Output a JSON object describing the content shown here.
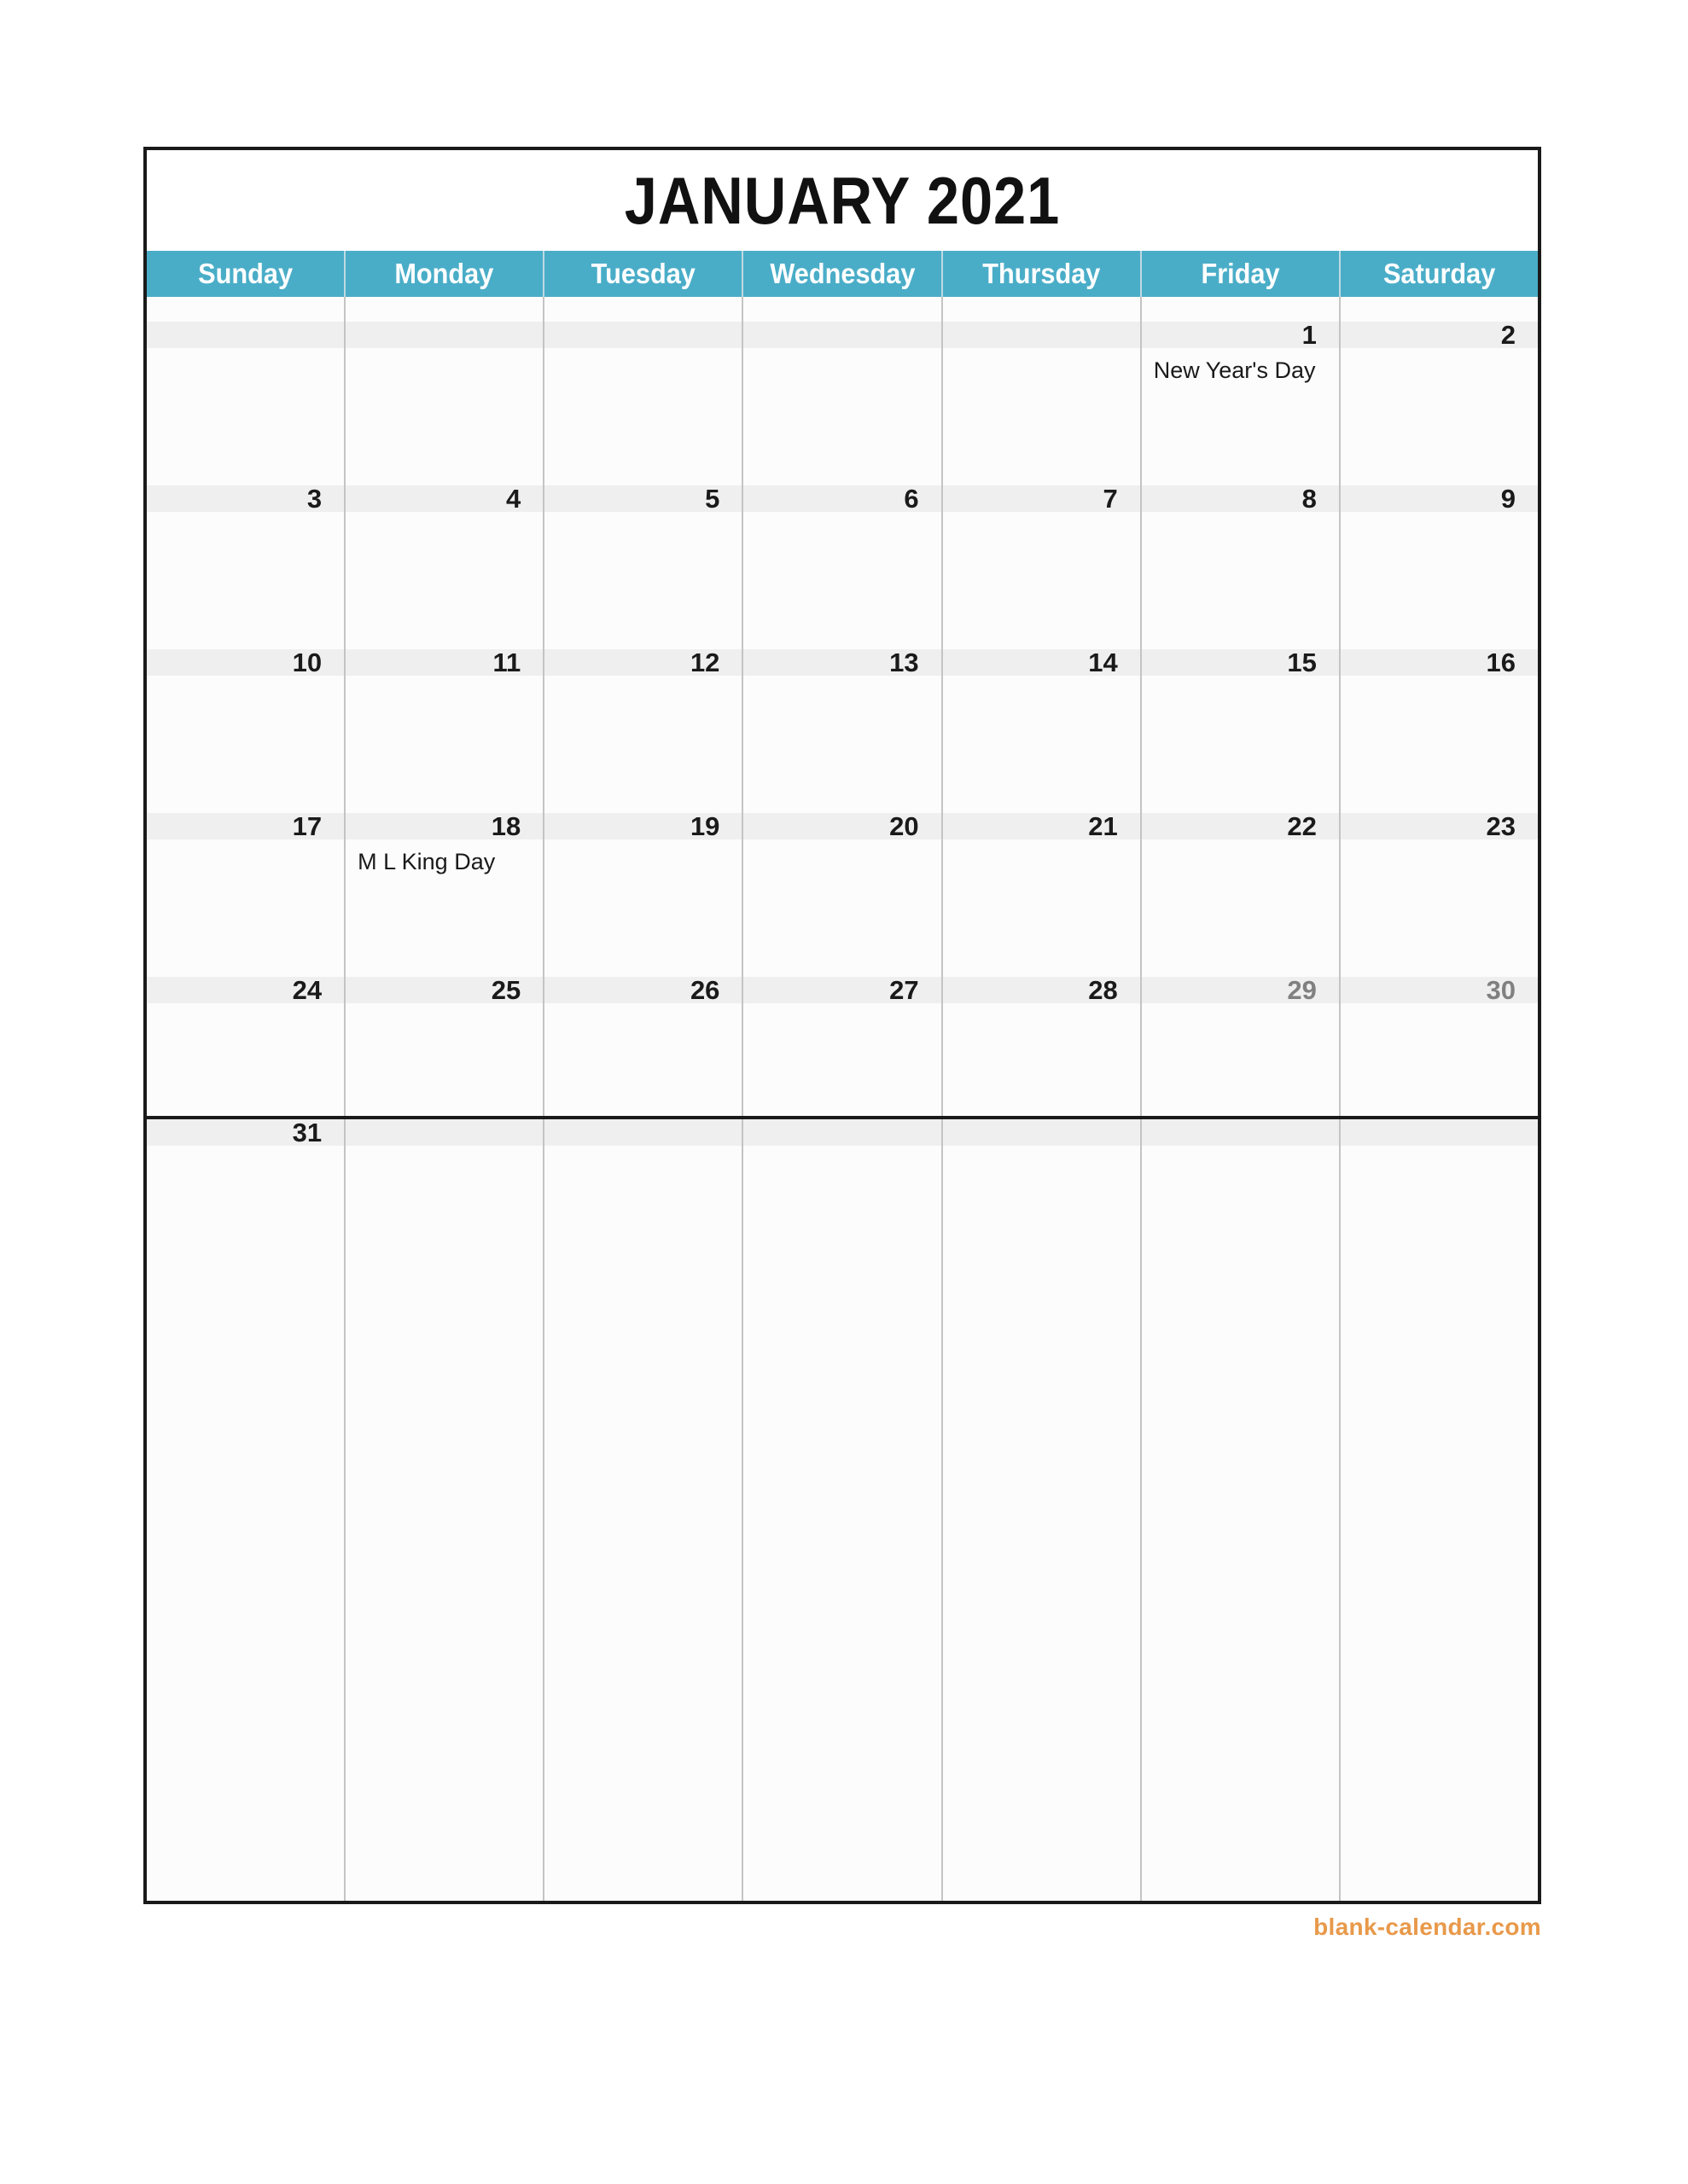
{
  "document": {
    "title": "JANUARY 2021",
    "month": "JANUARY",
    "year": "2021"
  },
  "colors": {
    "header_band": "#4aadc8",
    "header_text": "#ffffff",
    "date_band": "#efefef",
    "cell_background": "#fcfcfc",
    "frame_border": "#1a1a1a",
    "grid_line": "#c4c4c4",
    "date_text": "#1a1a1a",
    "date_text_muted": "#808080",
    "watermark": "#e8994a"
  },
  "weekdays": [
    {
      "label": "Sunday"
    },
    {
      "label": "Monday"
    },
    {
      "label": "Tuesday"
    },
    {
      "label": "Wednesday"
    },
    {
      "label": "Thursday"
    },
    {
      "label": "Friday"
    },
    {
      "label": "Saturday"
    }
  ],
  "weeks": [
    {
      "days": [
        {
          "date": "",
          "event": "",
          "muted": false
        },
        {
          "date": "",
          "event": "",
          "muted": false
        },
        {
          "date": "",
          "event": "",
          "muted": false
        },
        {
          "date": "",
          "event": "",
          "muted": false
        },
        {
          "date": "",
          "event": "",
          "muted": false
        },
        {
          "date": "1",
          "event": "New Year's Day",
          "muted": false
        },
        {
          "date": "2",
          "event": "",
          "muted": false
        }
      ]
    },
    {
      "days": [
        {
          "date": "3",
          "event": "",
          "muted": false
        },
        {
          "date": "4",
          "event": "",
          "muted": false
        },
        {
          "date": "5",
          "event": "",
          "muted": false
        },
        {
          "date": "6",
          "event": "",
          "muted": false
        },
        {
          "date": "7",
          "event": "",
          "muted": false
        },
        {
          "date": "8",
          "event": "",
          "muted": false
        },
        {
          "date": "9",
          "event": "",
          "muted": false
        }
      ]
    },
    {
      "days": [
        {
          "date": "10",
          "event": "",
          "muted": false
        },
        {
          "date": "11",
          "event": "",
          "muted": false
        },
        {
          "date": "12",
          "event": "",
          "muted": false
        },
        {
          "date": "13",
          "event": "",
          "muted": false
        },
        {
          "date": "14",
          "event": "",
          "muted": false
        },
        {
          "date": "15",
          "event": "",
          "muted": false
        },
        {
          "date": "16",
          "event": "",
          "muted": false
        }
      ]
    },
    {
      "days": [
        {
          "date": "17",
          "event": "",
          "muted": false
        },
        {
          "date": "18",
          "event": "M L King Day",
          "muted": false
        },
        {
          "date": "19",
          "event": "",
          "muted": false
        },
        {
          "date": "20",
          "event": "",
          "muted": false
        },
        {
          "date": "21",
          "event": "",
          "muted": false
        },
        {
          "date": "22",
          "event": "",
          "muted": false
        },
        {
          "date": "23",
          "event": "",
          "muted": false
        }
      ]
    },
    {
      "days": [
        {
          "date": "24",
          "event": "",
          "muted": false
        },
        {
          "date": "25",
          "event": "",
          "muted": false
        },
        {
          "date": "26",
          "event": "",
          "muted": false
        },
        {
          "date": "27",
          "event": "",
          "muted": false
        },
        {
          "date": "28",
          "event": "",
          "muted": false
        },
        {
          "date": "29",
          "event": "",
          "muted": true
        },
        {
          "date": "30",
          "event": "",
          "muted": true
        }
      ]
    },
    {
      "last": true,
      "days": [
        {
          "date": "31",
          "event": "",
          "muted": false
        },
        {
          "date": "",
          "event": "",
          "muted": false
        },
        {
          "date": "",
          "event": "",
          "muted": false
        },
        {
          "date": "",
          "event": "",
          "muted": false
        },
        {
          "date": "",
          "event": "",
          "muted": false
        },
        {
          "date": "",
          "event": "",
          "muted": false
        },
        {
          "date": "",
          "event": "",
          "muted": false
        }
      ]
    }
  ],
  "footer": {
    "watermark": "blank-calendar.com"
  }
}
